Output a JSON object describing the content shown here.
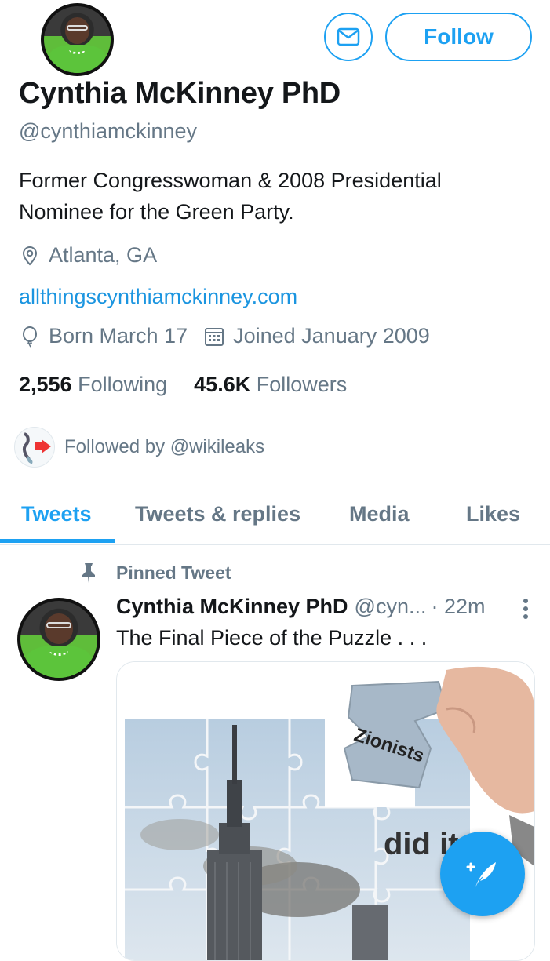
{
  "profile": {
    "name": "Cynthia McKinney PhD",
    "handle": "@cynthiamckinney",
    "bio": "Former Congresswoman & 2008 Presidential Nominee for the Green Party.",
    "location": "Atlanta, GA",
    "website": "allthingscynthiamckinney.com",
    "birthday": "Born March 17",
    "joined": "Joined January 2009",
    "following_count": "2,556",
    "following_label": "Following",
    "followers_count": "45.6K",
    "followers_label": "Followers",
    "followed_by": "Followed by @wikileaks"
  },
  "actions": {
    "follow_label": "Follow",
    "message_icon": "envelope-icon",
    "compose_icon": "compose-tweet-icon"
  },
  "tabs": [
    {
      "label": "Tweets",
      "active": true
    },
    {
      "label": "Tweets & replies",
      "active": false
    },
    {
      "label": "Media",
      "active": false
    },
    {
      "label": "Likes",
      "active": false
    }
  ],
  "tweet": {
    "pinned_label": "Pinned Tweet",
    "author_name": "Cynthia McKinney PhD",
    "author_handle": "@cyn...",
    "time": "· 22m",
    "text": "The Final Piece of the Puzzle . . .",
    "image_text_1": "Zionists",
    "image_text_2": "did it"
  },
  "colors": {
    "accent": "#1da1f2",
    "link": "#1b95e0",
    "secondary_text": "#657786",
    "primary_text": "#14171a"
  }
}
